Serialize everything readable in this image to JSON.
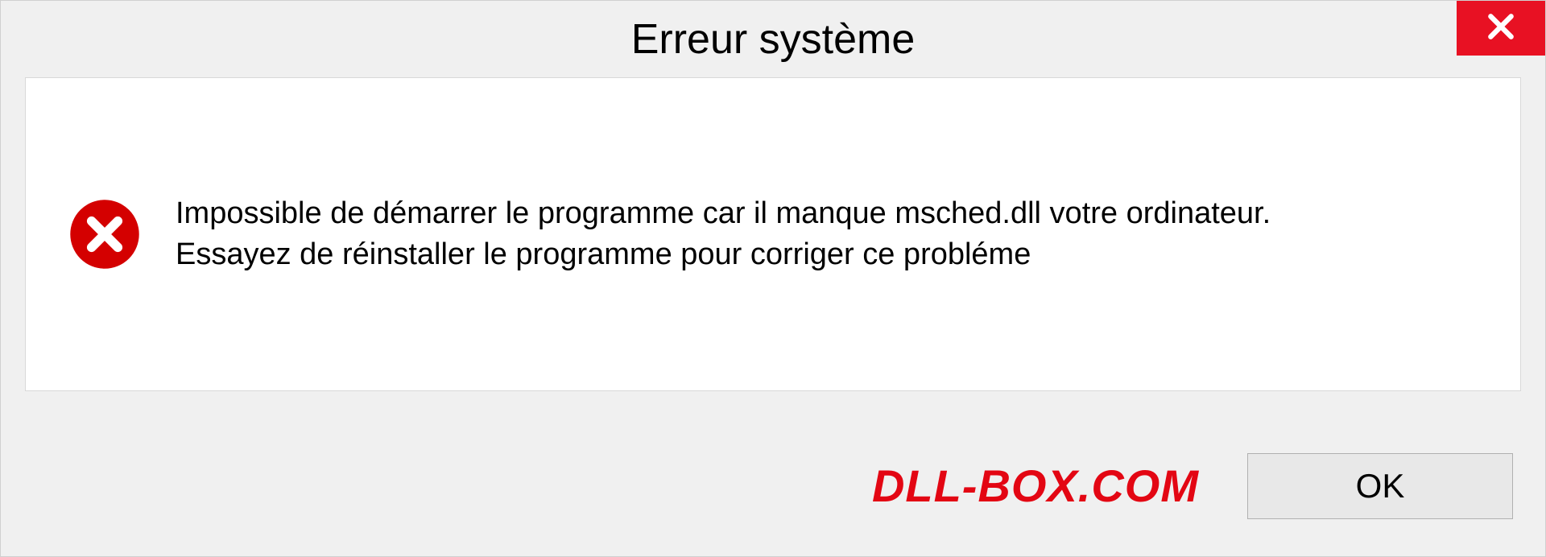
{
  "dialog": {
    "title": "Erreur système",
    "message": "Impossible de démarrer le programme car il manque msched.dll votre ordinateur. Essayez de réinstaller le programme pour corriger ce probléme",
    "ok_label": "OK"
  },
  "watermark": "DLL-BOX.COM",
  "colors": {
    "close_bg": "#e81123",
    "error_icon": "#d40000",
    "watermark": "#e30613"
  }
}
